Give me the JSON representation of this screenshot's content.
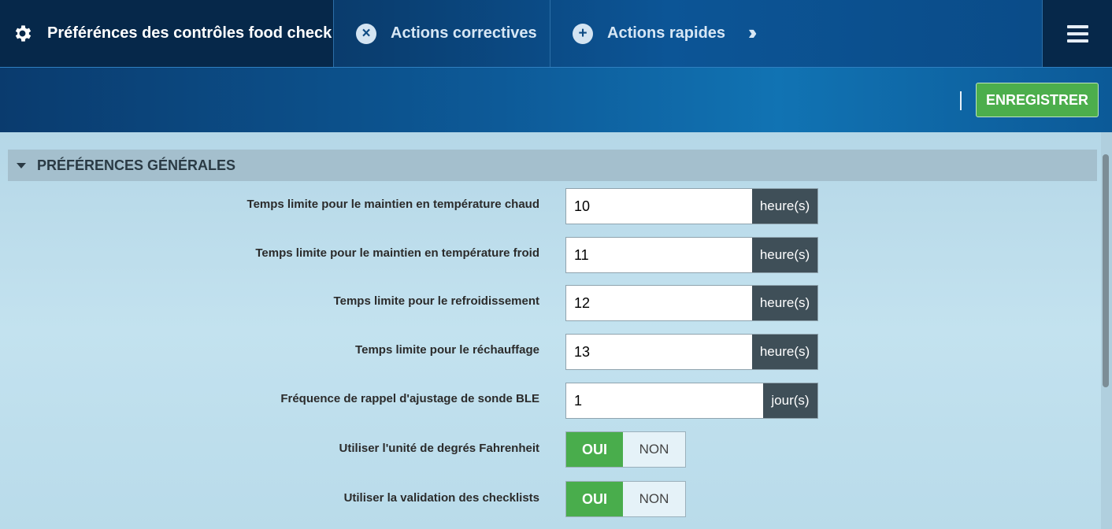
{
  "nav": {
    "active_tab": "Préférénces des contrôles food check",
    "tab_corrective": "Actions correctives",
    "tab_quick": "Actions rapides"
  },
  "toolbar": {
    "save_label": "ENREGISTRER"
  },
  "section": {
    "title": "PRÉFÉRENCES GÉNÉRALES"
  },
  "fields": [
    {
      "label": "Temps limite pour le maintien en température chaud",
      "value": "10",
      "unit": "heure(s)"
    },
    {
      "label": "Temps limite pour le maintien en température froid",
      "value": "11",
      "unit": "heure(s)"
    },
    {
      "label": "Temps limite pour le refroidissement",
      "value": "12",
      "unit": "heure(s)"
    },
    {
      "label": "Temps limite pour le réchauffage",
      "value": "13",
      "unit": "heure(s)"
    },
    {
      "label": "Fréquence de rappel d'ajustage de sonde BLE",
      "value": "1",
      "unit": "jour(s)"
    }
  ],
  "toggles": [
    {
      "label": "Utiliser l'unité de degrés Fahrenheit",
      "yes": "OUI",
      "no": "NON",
      "selected": "OUI"
    },
    {
      "label": "Utiliser la validation des checklists",
      "yes": "OUI",
      "no": "NON",
      "selected": "OUI"
    }
  ],
  "colors": {
    "accent_green": "#4cae4c",
    "nav_dark": "#06284a",
    "unit_bg": "#3f4f58"
  }
}
